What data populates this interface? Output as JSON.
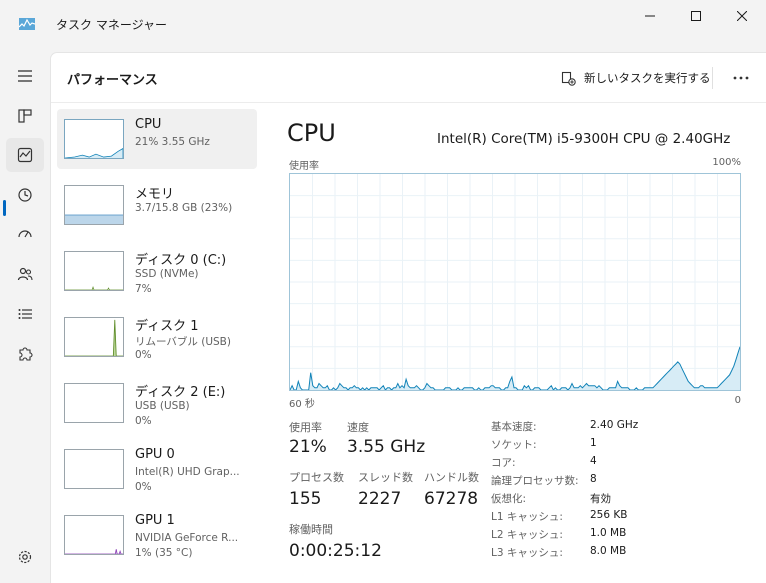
{
  "window": {
    "title": "タスク マネージャー"
  },
  "header": {
    "page_title": "パフォーマンス",
    "new_task_label": "新しいタスクを実行する"
  },
  "devices": [
    {
      "name": "CPU",
      "sub1": "21%  3.55 GHz",
      "sub2": ""
    },
    {
      "name": "メモリ",
      "sub1": "3.7/15.8 GB (23%)",
      "sub2": ""
    },
    {
      "name": "ディスク 0 (C:)",
      "sub1": "SSD (NVMe)",
      "sub2": "7%"
    },
    {
      "name": "ディスク 1",
      "sub1": "リムーバブル (USB)",
      "sub2": "0%"
    },
    {
      "name": "ディスク 2 (E:)",
      "sub1": "USB (USB)",
      "sub2": "0%"
    },
    {
      "name": "GPU 0",
      "sub1": "Intel(R) UHD Grap...",
      "sub2": "0%"
    },
    {
      "name": "GPU 1",
      "sub1": "NVIDIA GeForce R...",
      "sub2": "1% (35 °C)"
    }
  ],
  "detail": {
    "title": "CPU",
    "model": "Intel(R) Core(TM) i5-9300H CPU @ 2.40GHz",
    "graph_label": "使用率",
    "graph_max": "100%",
    "axis_left": "60 秒",
    "axis_right": "0",
    "usage": [
      0,
      2,
      0,
      0,
      4,
      1,
      0,
      0,
      0,
      0,
      8,
      2,
      1,
      1,
      3,
      2,
      1,
      1,
      2,
      0,
      0,
      1,
      0,
      1,
      3,
      2,
      1,
      1,
      0,
      1,
      1,
      2,
      1,
      1,
      0,
      1,
      0,
      1,
      0,
      1,
      1,
      1,
      1,
      0,
      1,
      2,
      0,
      1,
      1,
      0,
      1,
      1,
      3,
      1,
      2,
      1,
      5,
      2,
      1,
      1,
      1,
      2,
      1,
      0,
      0,
      1,
      3,
      2,
      1,
      1,
      0,
      0,
      0,
      0,
      0,
      1,
      1,
      1,
      0,
      0,
      0,
      1,
      0,
      0,
      1,
      1,
      1,
      1,
      1,
      0,
      0,
      1,
      0,
      0,
      1,
      1,
      1,
      2,
      2,
      1,
      1,
      1,
      0,
      0,
      1,
      1,
      4,
      6,
      1,
      1,
      0,
      0,
      0,
      2,
      1,
      2,
      0,
      0,
      1,
      1,
      1,
      0,
      0,
      0,
      0,
      1,
      2,
      0,
      1,
      0,
      0,
      1,
      1,
      1,
      0,
      1,
      3,
      1,
      1,
      1,
      2,
      1,
      2,
      3,
      2,
      2,
      2,
      2,
      1,
      2,
      1,
      0,
      0,
      0,
      1,
      1,
      1,
      1,
      4,
      2,
      1,
      1,
      1,
      1,
      0,
      0,
      0,
      1,
      0,
      0,
      0,
      1,
      1,
      1,
      1,
      1,
      2,
      3,
      4,
      5,
      6,
      7,
      8,
      9,
      10,
      11,
      12,
      13,
      12,
      10,
      8,
      6,
      4,
      3,
      2,
      1,
      1,
      1,
      2,
      2,
      1,
      1,
      1,
      1,
      1,
      1,
      1,
      2,
      3,
      4,
      5,
      6,
      7,
      9,
      11,
      14,
      17,
      20
    ],
    "stats": {
      "usage_label": "使用率",
      "usage_value": "21%",
      "speed_label": "速度",
      "speed_value": "3.55 GHz",
      "processes_label": "プロセス数",
      "processes_value": "155",
      "threads_label": "スレッド数",
      "threads_value": "2227",
      "handles_label": "ハンドル数",
      "handles_value": "67278",
      "uptime_label": "稼働時間",
      "uptime_value": "0:00:25:12"
    },
    "specs": [
      {
        "key": "基本速度:",
        "value": "2.40 GHz"
      },
      {
        "key": "ソケット:",
        "value": "1"
      },
      {
        "key": "コア:",
        "value": "4"
      },
      {
        "key": "論理プロセッサ数:",
        "value": "8"
      },
      {
        "key": "仮想化:",
        "value": "有効"
      },
      {
        "key": "L1 キャッシュ:",
        "value": "256 KB"
      },
      {
        "key": "L2 キャッシュ:",
        "value": "1.0 MB"
      },
      {
        "key": "L3 キャッシュ:",
        "value": "8.0 MB"
      }
    ]
  },
  "colors": {
    "cpu_line": "#1183b8",
    "cpu_fill": "#d7ecf6",
    "grid": "#eaf2f7",
    "accent": "#0067c0",
    "disk_line": "#5f8d2a",
    "gpu_line": "#8a3fb5"
  }
}
